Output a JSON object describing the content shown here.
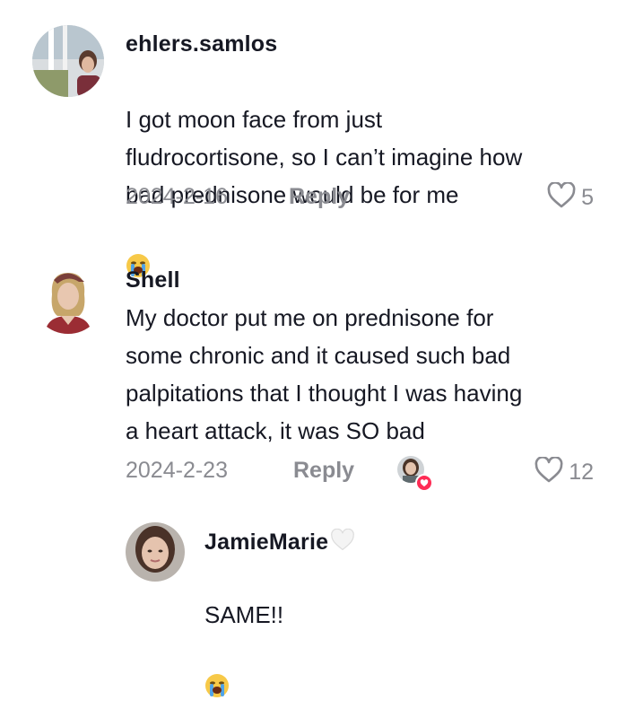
{
  "comments": [
    {
      "username": "ehlers.samlos",
      "text": "I got moon face from just\nfludrocortisone, so I can’t imagine how\nbad prednisone would be for me",
      "emoji": "loudly-crying-face-icon",
      "date": "2024-2-16",
      "reply_label": "Reply",
      "likes": "5"
    },
    {
      "username": "Shell",
      "text": "My doctor put me on prednisone for\nsome chronic and it caused such bad\npalpitations that I thought I was having\na heart attack, it was SO bad",
      "date": "2024-2-23",
      "reply_label": "Reply",
      "likes": "12",
      "creator_liked": true
    }
  ],
  "reply": {
    "username": "JamieMarie",
    "username_badge": "white-heart-icon",
    "text": "SAME!!",
    "emoji": "loudly-crying-face-icon"
  },
  "colors": {
    "secondary_text": "#8a8b91",
    "primary_text": "#161823",
    "liked_badge": "#fe2c55"
  }
}
